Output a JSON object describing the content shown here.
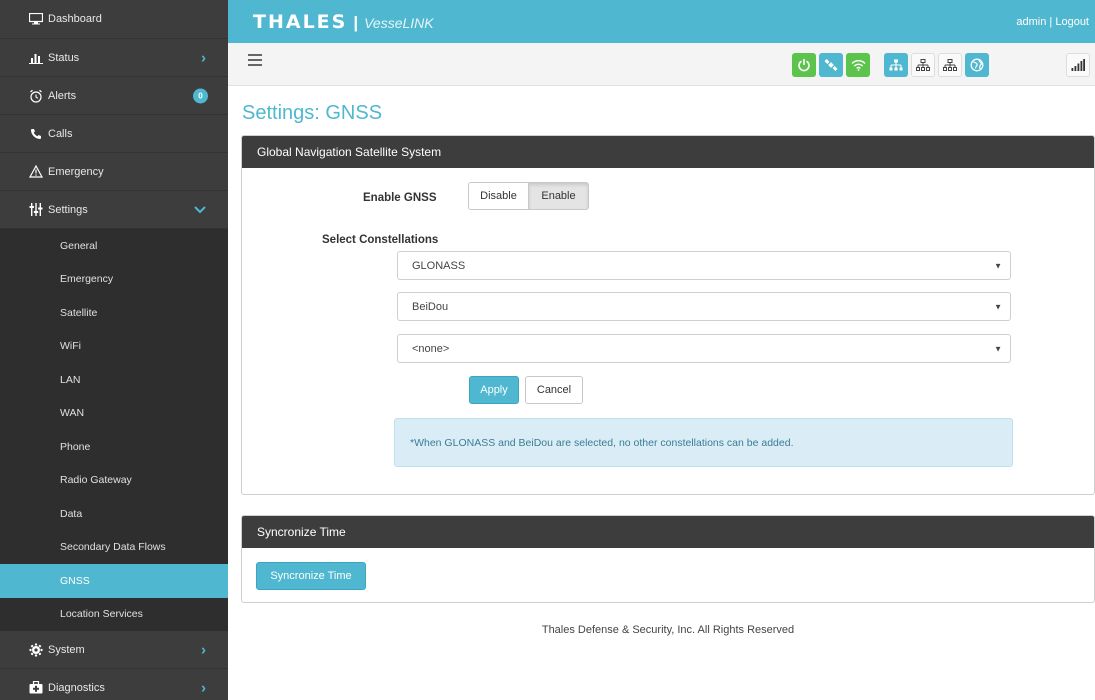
{
  "sidebar": {
    "dashboard": "Dashboard",
    "status": "Status",
    "alerts": "Alerts",
    "alerts_badge": "0",
    "calls": "Calls",
    "emergency": "Emergency",
    "settings": "Settings",
    "settings_sub": [
      "General",
      "Emergency",
      "Satellite",
      "WiFi",
      "LAN",
      "WAN",
      "Phone",
      "Radio Gateway",
      "Data",
      "Secondary Data Flows",
      "GNSS",
      "Location Services"
    ],
    "active_sub": "GNSS",
    "system": "System",
    "diagnostics": "Diagnostics"
  },
  "header": {
    "logo": "THALES",
    "separator": "|",
    "product": "VesseLINK",
    "admin": "admin",
    "divider": "|",
    "logout": "Logout"
  },
  "toolbar_icons": [
    "power-icon",
    "satellite-icon",
    "wifi-icon",
    "network-icon",
    "network-icon",
    "network-icon",
    "globe-icon",
    "signal-strength-icon"
  ],
  "page": {
    "title": "Settings: GNSS"
  },
  "gnss_panel": {
    "title": "Global Navigation Satellite System",
    "enable_label": "Enable GNSS",
    "disable_btn": "Disable",
    "enable_btn": "Enable",
    "enabled": true,
    "constellations_label": "Select Constellations",
    "constellation_1": "GLONASS",
    "constellation_2": "BeiDou",
    "constellation_3": "<none>",
    "apply_btn": "Apply",
    "cancel_btn": "Cancel",
    "info": "*When GLONASS and BeiDou are selected, no other constellations can be added."
  },
  "sync_panel": {
    "title": "Syncronize Time",
    "button": "Syncronize Time"
  },
  "footer": "Thales Defense & Security, Inc. All Rights Reserved",
  "colors": {
    "accent": "#4fb8d0",
    "sidebar_bg": "#3d3d3d",
    "green": "#5cc34d"
  }
}
